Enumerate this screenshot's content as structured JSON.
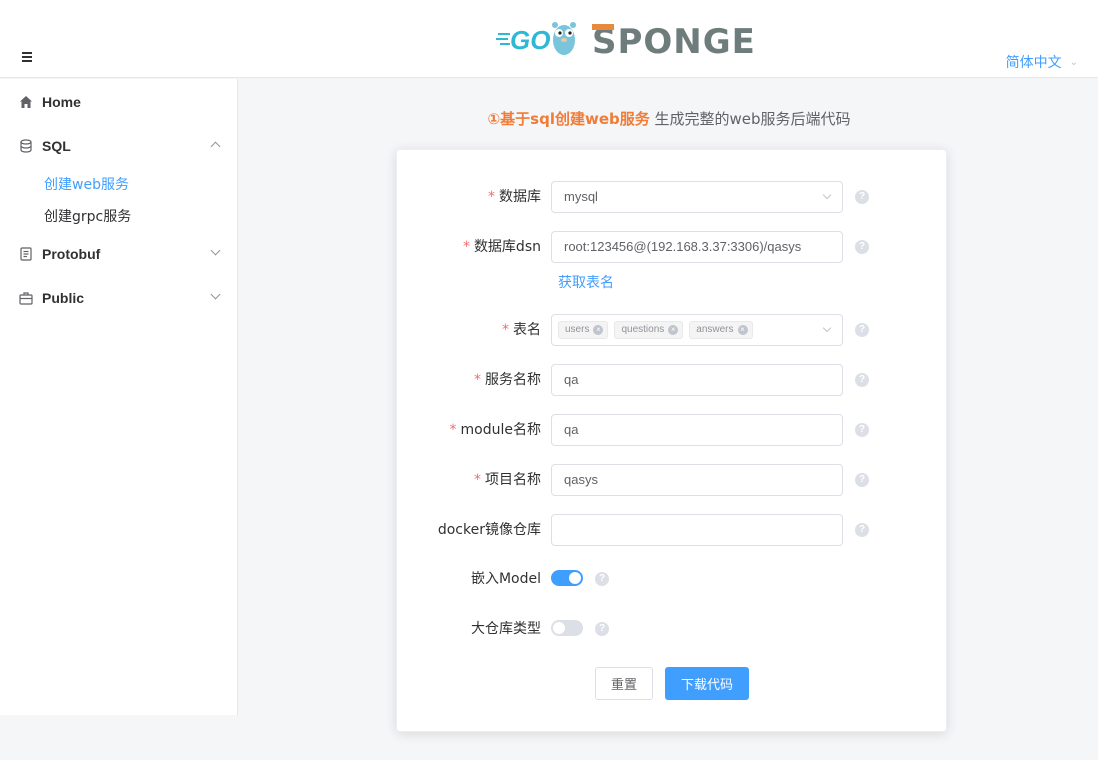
{
  "header": {
    "logo_text_go": "GO",
    "logo_text_sponge": "SPONGE",
    "language": "简体中文"
  },
  "sidebar": {
    "items": [
      {
        "label": "Home",
        "icon": "home-icon"
      },
      {
        "label": "SQL",
        "icon": "database-icon",
        "expanded": true,
        "children": [
          {
            "label": "创建web服务",
            "active": true
          },
          {
            "label": "创建grpc服务",
            "active": false
          }
        ]
      },
      {
        "label": "Protobuf",
        "icon": "document-icon",
        "expanded": false
      },
      {
        "label": "Public",
        "icon": "briefcase-icon",
        "expanded": false
      }
    ]
  },
  "main": {
    "subtitle_highlight": "①基于sql创建web服务",
    "subtitle_rest": " 生成完整的web服务后端代码",
    "form": {
      "database": {
        "label": "数据库",
        "required": true,
        "value": "mysql"
      },
      "dsn": {
        "label": "数据库dsn",
        "required": true,
        "value": "root:123456@(192.168.3.37:3306)/qasys"
      },
      "get_tables_link": "获取表名",
      "tables": {
        "label": "表名",
        "required": true,
        "tags": [
          "users",
          "questions",
          "answers"
        ]
      },
      "service_name": {
        "label": "服务名称",
        "required": true,
        "value": "qa"
      },
      "module_name": {
        "label": "module名称",
        "required": true,
        "value": "qa"
      },
      "project_name": {
        "label": "项目名称",
        "required": true,
        "value": "qasys"
      },
      "docker_repo": {
        "label": "docker镜像仓库",
        "required": false,
        "value": ""
      },
      "embed_model": {
        "label": "嵌入Model",
        "value": true
      },
      "mono_repo": {
        "label": "大仓库类型",
        "value": false
      },
      "help_symbol": "?",
      "tag_close_symbol": "×",
      "required_mark": "*",
      "reset_label": "重置",
      "download_label": "下载代码"
    }
  },
  "colors": {
    "accent": "#409eff",
    "highlight": "#f07c37",
    "required": "#f56c6c"
  }
}
